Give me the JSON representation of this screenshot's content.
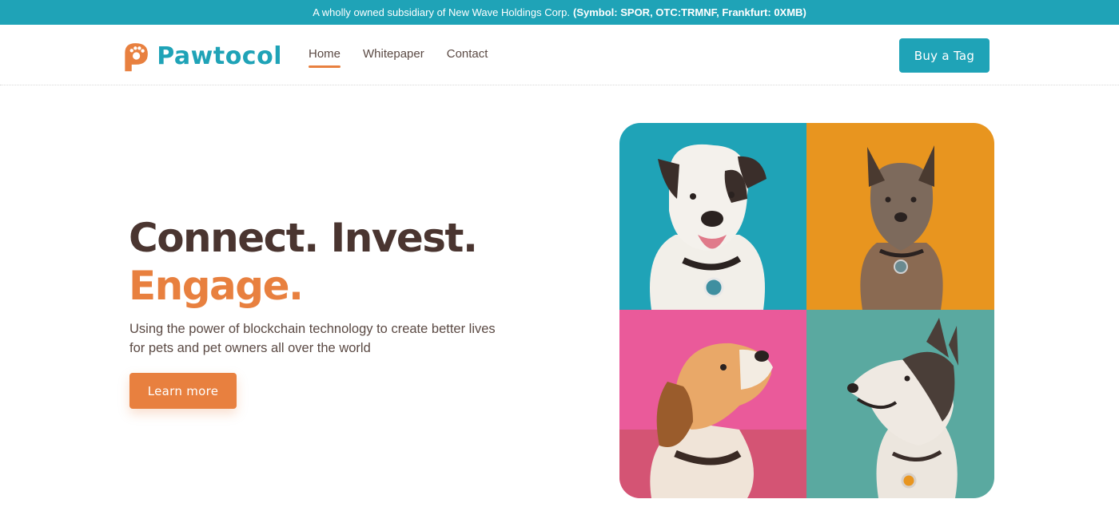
{
  "announcement": {
    "text": "A wholly owned subsidiary of New Wave Holdings Corp.",
    "bold": "(Symbol: SPOR, OTC:TRMNF, Frankfurt: 0XMB)"
  },
  "brand": {
    "name": "Pawtocol",
    "primary_color": "#1fa3b7",
    "accent_color": "#e8803f"
  },
  "nav": {
    "items": [
      {
        "label": "Home",
        "active": true
      },
      {
        "label": "Whitepaper",
        "active": false
      },
      {
        "label": "Contact",
        "active": false
      }
    ]
  },
  "header": {
    "cta_label": "Buy a Tag"
  },
  "hero": {
    "headline_line1": "Connect. Invest.",
    "headline_line2": "Engage.",
    "subtitle": "Using the power of blockchain technology to create better lives for pets and pet owners all over the world",
    "button_label": "Learn more"
  },
  "collage": {
    "tiles": [
      {
        "subject": "white dog with pet tag",
        "background": "#1fa3b7"
      },
      {
        "subject": "yorkshire terrier with pet tag",
        "background": "#e8951f"
      },
      {
        "subject": "beagle looking up",
        "background": "#ea5a9a"
      },
      {
        "subject": "husky with pet tag",
        "background": "#5aa9a0"
      }
    ]
  }
}
